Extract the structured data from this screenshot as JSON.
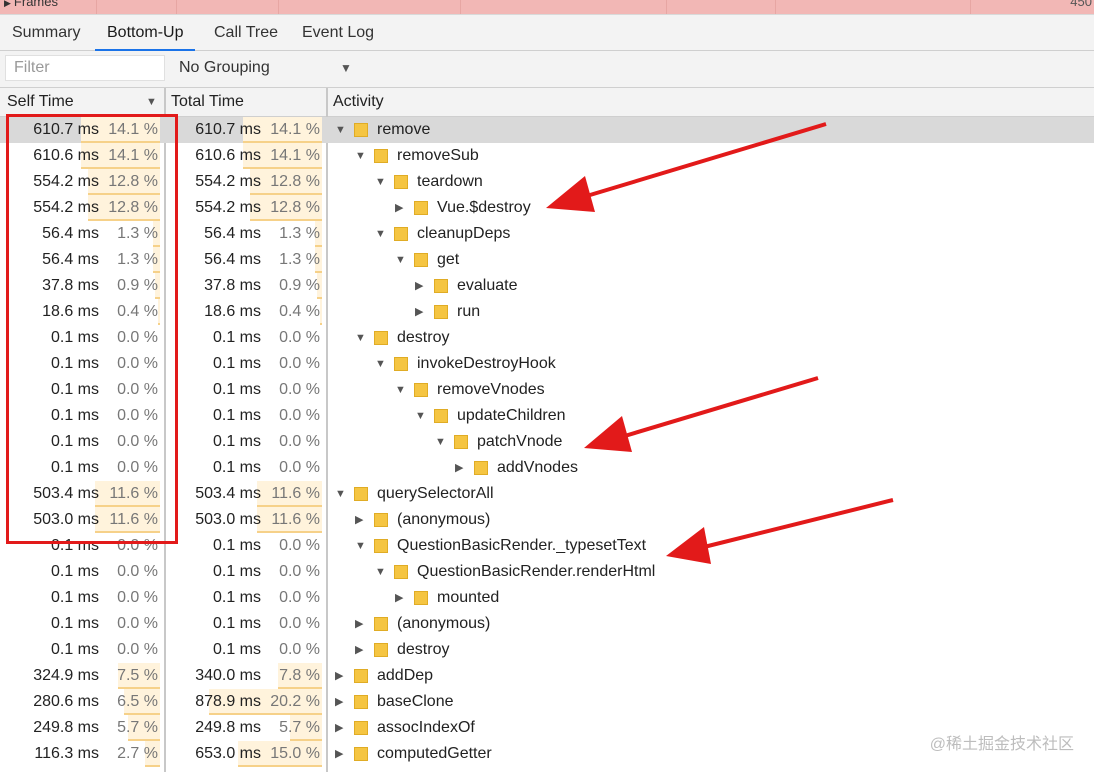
{
  "frames": {
    "label": "Frames",
    "value": "450"
  },
  "tabs": [
    {
      "label": "Summary",
      "active": false
    },
    {
      "label": "Bottom-Up",
      "active": true
    },
    {
      "label": "Call Tree",
      "active": false
    },
    {
      "label": "Event Log",
      "active": false
    }
  ],
  "filter": {
    "placeholder": "Filter",
    "value": ""
  },
  "grouping": {
    "selected": "No Grouping"
  },
  "columns": {
    "self_time": "Self Time",
    "total_time": "Total Time",
    "activity": "Activity"
  },
  "colors": {
    "annotation": "#e21a1a",
    "folder": "#f5c542",
    "bar": "#fff3dc",
    "selected_row": "#d9d9d9"
  },
  "rows": [
    {
      "self_ms": "610.7 ms",
      "self_pct": "14.1 %",
      "self_frac": 0.141,
      "total_ms": "610.7 ms",
      "total_pct": "14.1 %",
      "total_frac": 0.141,
      "depth": 0,
      "expander": "expanded",
      "name": "remove",
      "selected": true
    },
    {
      "self_ms": "610.6 ms",
      "self_pct": "14.1 %",
      "self_frac": 0.141,
      "total_ms": "610.6 ms",
      "total_pct": "14.1 %",
      "total_frac": 0.141,
      "depth": 1,
      "expander": "expanded",
      "name": "removeSub"
    },
    {
      "self_ms": "554.2 ms",
      "self_pct": "12.8 %",
      "self_frac": 0.128,
      "total_ms": "554.2 ms",
      "total_pct": "12.8 %",
      "total_frac": 0.128,
      "depth": 2,
      "expander": "expanded",
      "name": "teardown"
    },
    {
      "self_ms": "554.2 ms",
      "self_pct": "12.8 %",
      "self_frac": 0.128,
      "total_ms": "554.2 ms",
      "total_pct": "12.8 %",
      "total_frac": 0.128,
      "depth": 3,
      "expander": "collapsed",
      "name": "Vue.$destroy"
    },
    {
      "self_ms": "56.4 ms",
      "self_pct": "1.3 %",
      "self_frac": 0.013,
      "total_ms": "56.4 ms",
      "total_pct": "1.3 %",
      "total_frac": 0.013,
      "depth": 2,
      "expander": "expanded",
      "name": "cleanupDeps"
    },
    {
      "self_ms": "56.4 ms",
      "self_pct": "1.3 %",
      "self_frac": 0.013,
      "total_ms": "56.4 ms",
      "total_pct": "1.3 %",
      "total_frac": 0.013,
      "depth": 3,
      "expander": "expanded",
      "name": "get"
    },
    {
      "self_ms": "37.8 ms",
      "self_pct": "0.9 %",
      "self_frac": 0.009,
      "total_ms": "37.8 ms",
      "total_pct": "0.9 %",
      "total_frac": 0.009,
      "depth": 4,
      "expander": "collapsed",
      "name": "evaluate"
    },
    {
      "self_ms": "18.6 ms",
      "self_pct": "0.4 %",
      "self_frac": 0.004,
      "total_ms": "18.6 ms",
      "total_pct": "0.4 %",
      "total_frac": 0.004,
      "depth": 4,
      "expander": "collapsed",
      "name": "run"
    },
    {
      "self_ms": "0.1 ms",
      "self_pct": "0.0 %",
      "self_frac": 0,
      "total_ms": "0.1 ms",
      "total_pct": "0.0 %",
      "total_frac": 0,
      "depth": 1,
      "expander": "expanded",
      "name": "destroy"
    },
    {
      "self_ms": "0.1 ms",
      "self_pct": "0.0 %",
      "self_frac": 0,
      "total_ms": "0.1 ms",
      "total_pct": "0.0 %",
      "total_frac": 0,
      "depth": 2,
      "expander": "expanded",
      "name": "invokeDestroyHook"
    },
    {
      "self_ms": "0.1 ms",
      "self_pct": "0.0 %",
      "self_frac": 0,
      "total_ms": "0.1 ms",
      "total_pct": "0.0 %",
      "total_frac": 0,
      "depth": 3,
      "expander": "expanded",
      "name": "removeVnodes"
    },
    {
      "self_ms": "0.1 ms",
      "self_pct": "0.0 %",
      "self_frac": 0,
      "total_ms": "0.1 ms",
      "total_pct": "0.0 %",
      "total_frac": 0,
      "depth": 4,
      "expander": "expanded",
      "name": "updateChildren"
    },
    {
      "self_ms": "0.1 ms",
      "self_pct": "0.0 %",
      "self_frac": 0,
      "total_ms": "0.1 ms",
      "total_pct": "0.0 %",
      "total_frac": 0,
      "depth": 5,
      "expander": "expanded",
      "name": "patchVnode"
    },
    {
      "self_ms": "0.1 ms",
      "self_pct": "0.0 %",
      "self_frac": 0,
      "total_ms": "0.1 ms",
      "total_pct": "0.0 %",
      "total_frac": 0,
      "depth": 6,
      "expander": "collapsed",
      "name": "addVnodes"
    },
    {
      "self_ms": "503.4 ms",
      "self_pct": "11.6 %",
      "self_frac": 0.116,
      "total_ms": "503.4 ms",
      "total_pct": "11.6 %",
      "total_frac": 0.116,
      "depth": 0,
      "expander": "expanded",
      "name": "querySelectorAll"
    },
    {
      "self_ms": "503.0 ms",
      "self_pct": "11.6 %",
      "self_frac": 0.116,
      "total_ms": "503.0 ms",
      "total_pct": "11.6 %",
      "total_frac": 0.116,
      "depth": 1,
      "expander": "collapsed",
      "name": "(anonymous)"
    },
    {
      "self_ms": "0.1 ms",
      "self_pct": "0.0 %",
      "self_frac": 0,
      "total_ms": "0.1 ms",
      "total_pct": "0.0 %",
      "total_frac": 0,
      "depth": 1,
      "expander": "expanded",
      "name": "QuestionBasicRender._typesetText"
    },
    {
      "self_ms": "0.1 ms",
      "self_pct": "0.0 %",
      "self_frac": 0,
      "total_ms": "0.1 ms",
      "total_pct": "0.0 %",
      "total_frac": 0,
      "depth": 2,
      "expander": "expanded",
      "name": "QuestionBasicRender.renderHtml"
    },
    {
      "self_ms": "0.1 ms",
      "self_pct": "0.0 %",
      "self_frac": 0,
      "total_ms": "0.1 ms",
      "total_pct": "0.0 %",
      "total_frac": 0,
      "depth": 3,
      "expander": "collapsed",
      "name": "mounted"
    },
    {
      "self_ms": "0.1 ms",
      "self_pct": "0.0 %",
      "self_frac": 0,
      "total_ms": "0.1 ms",
      "total_pct": "0.0 %",
      "total_frac": 0,
      "depth": 1,
      "expander": "collapsed",
      "name": "(anonymous)"
    },
    {
      "self_ms": "0.1 ms",
      "self_pct": "0.0 %",
      "self_frac": 0,
      "total_ms": "0.1 ms",
      "total_pct": "0.0 %",
      "total_frac": 0,
      "depth": 1,
      "expander": "collapsed",
      "name": "destroy"
    },
    {
      "self_ms": "324.9 ms",
      "self_pct": "7.5 %",
      "self_frac": 0.075,
      "total_ms": "340.0 ms",
      "total_pct": "7.8 %",
      "total_frac": 0.078,
      "depth": 0,
      "expander": "collapsed",
      "name": "addDep"
    },
    {
      "self_ms": "280.6 ms",
      "self_pct": "6.5 %",
      "self_frac": 0.065,
      "total_ms": "878.9 ms",
      "total_pct": "20.2 %",
      "total_frac": 0.202,
      "depth": 0,
      "expander": "collapsed",
      "name": "baseClone"
    },
    {
      "self_ms": "249.8 ms",
      "self_pct": "5.7 %",
      "self_frac": 0.057,
      "total_ms": "249.8 ms",
      "total_pct": "5.7 %",
      "total_frac": 0.057,
      "depth": 0,
      "expander": "collapsed",
      "name": "assocIndexOf"
    },
    {
      "self_ms": "116.3 ms",
      "self_pct": "2.7 %",
      "self_frac": 0.027,
      "total_ms": "653.0 ms",
      "total_pct": "15.0 %",
      "total_frac": 0.15,
      "depth": 0,
      "expander": "collapsed",
      "name": "computedGetter"
    }
  ],
  "watermark": "@稀土掘金技术社区"
}
